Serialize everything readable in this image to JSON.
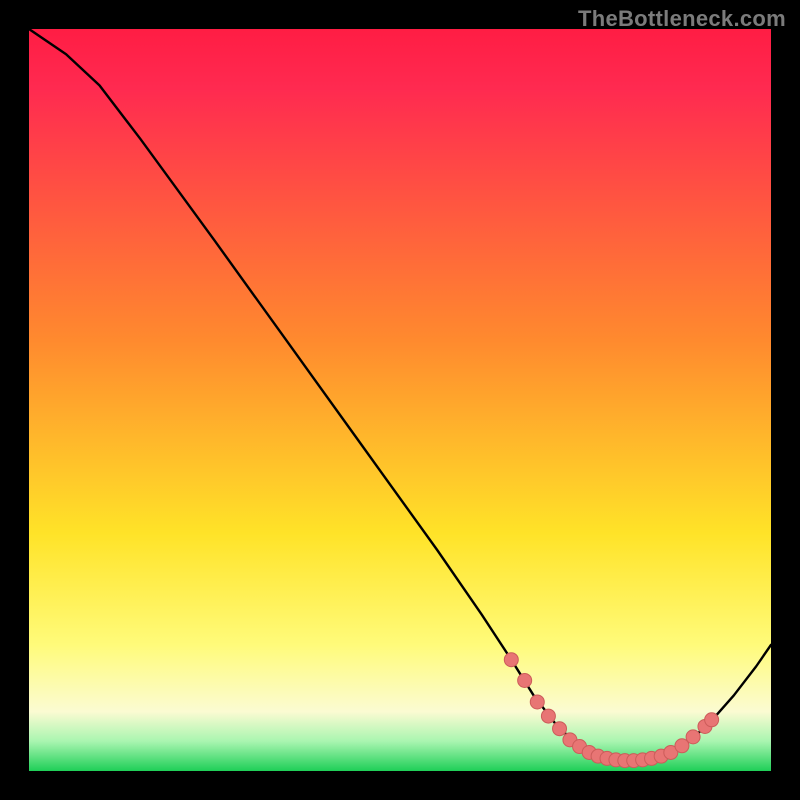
{
  "branding": {
    "watermark": "TheBottleneck.com"
  },
  "colors": {
    "curve": "#000000",
    "dot_fill": "#e87574",
    "dot_stroke": "#cc5c5a",
    "grad_top": "#ff1d44",
    "grad_mag": "#ff2a50",
    "grad_orange": "#ff8a2e",
    "grad_yellow": "#ffe328",
    "grad_paleY": "#fffb7a",
    "grad_cream": "#fbfbd2",
    "grad_mint": "#a9f5b0",
    "grad_green": "#1fcf57"
  },
  "chart_data": {
    "type": "line",
    "title": "",
    "xlabel": "",
    "ylabel": "",
    "xlim": [
      0,
      100
    ],
    "ylim": [
      0,
      100
    ],
    "curve": [
      {
        "x": 0.0,
        "y": 100.0
      },
      {
        "x": 5.0,
        "y": 96.6
      },
      {
        "x": 9.5,
        "y": 92.4
      },
      {
        "x": 15.0,
        "y": 85.2
      },
      {
        "x": 25.0,
        "y": 71.5
      },
      {
        "x": 35.0,
        "y": 57.6
      },
      {
        "x": 45.0,
        "y": 43.7
      },
      {
        "x": 55.0,
        "y": 29.8
      },
      {
        "x": 61.0,
        "y": 21.1
      },
      {
        "x": 65.0,
        "y": 15.0
      },
      {
        "x": 68.0,
        "y": 10.2
      },
      {
        "x": 71.0,
        "y": 6.3
      },
      {
        "x": 74.0,
        "y": 3.4
      },
      {
        "x": 77.0,
        "y": 1.9
      },
      {
        "x": 80.0,
        "y": 1.4
      },
      {
        "x": 83.0,
        "y": 1.5
      },
      {
        "x": 86.0,
        "y": 2.2
      },
      {
        "x": 89.0,
        "y": 4.0
      },
      {
        "x": 92.0,
        "y": 6.8
      },
      {
        "x": 95.0,
        "y": 10.2
      },
      {
        "x": 98.0,
        "y": 14.1
      },
      {
        "x": 100.0,
        "y": 17.0
      }
    ],
    "dots": [
      {
        "x": 65.0,
        "y": 15.0
      },
      {
        "x": 66.8,
        "y": 12.2
      },
      {
        "x": 68.5,
        "y": 9.3
      },
      {
        "x": 70.0,
        "y": 7.4
      },
      {
        "x": 71.5,
        "y": 5.7
      },
      {
        "x": 72.9,
        "y": 4.2
      },
      {
        "x": 74.2,
        "y": 3.3
      },
      {
        "x": 75.5,
        "y": 2.5
      },
      {
        "x": 76.7,
        "y": 2.0
      },
      {
        "x": 77.9,
        "y": 1.7
      },
      {
        "x": 79.1,
        "y": 1.5
      },
      {
        "x": 80.3,
        "y": 1.4
      },
      {
        "x": 81.5,
        "y": 1.4
      },
      {
        "x": 82.7,
        "y": 1.5
      },
      {
        "x": 83.9,
        "y": 1.7
      },
      {
        "x": 85.2,
        "y": 2.0
      },
      {
        "x": 86.5,
        "y": 2.5
      },
      {
        "x": 88.0,
        "y": 3.4
      },
      {
        "x": 89.5,
        "y": 4.6
      },
      {
        "x": 91.1,
        "y": 6.0
      },
      {
        "x": 92.0,
        "y": 6.9
      }
    ]
  }
}
